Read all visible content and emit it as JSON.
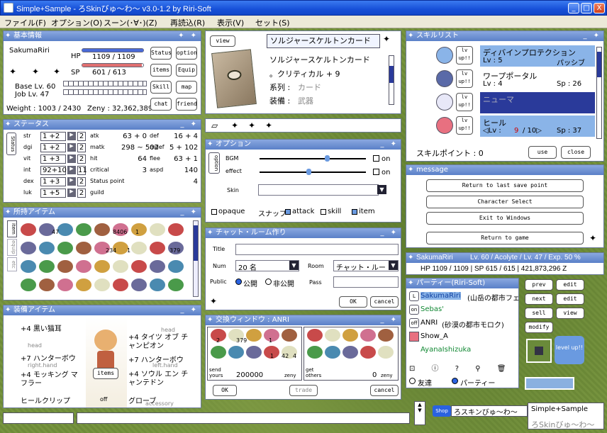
{
  "window": {
    "title": "Simple+Sample - ろSkinびゅ～わ～ v3.0-1.2 by Riri-Soft",
    "min": "_",
    "max": "□",
    "close": "X"
  },
  "menu": [
    "ファイル(F)",
    "オプション(O)",
    "スーン(･∀･)(Z)",
    "再読込(R)",
    "表示(V)",
    "セット(S)"
  ],
  "basic": {
    "title": "基本情報",
    "name": "SakumaRiri",
    "hp_label": "HP",
    "hp": "1109 / 1109",
    "sp_label": "SP",
    "sp": "601 / 613",
    "base_lv": "Base Lv. 60",
    "job_lv": "Job Lv. 47",
    "weight": "Weight : 1003 / 2430",
    "zeny": "Zeny : 32,362,389",
    "buttons": [
      "Status",
      "option",
      "items",
      "Equip",
      "Skill",
      "map",
      "chat",
      "friend"
    ],
    "hp_ratio": 1.0,
    "sp_ratio": 0.98
  },
  "status": {
    "title": "ステータス",
    "side": "Status",
    "rows": [
      {
        "k": "str",
        "v": "1 +2",
        "p": "2",
        "k2": "atk",
        "v2": "63 + 0",
        "k3": "def",
        "v3": "16 + 4"
      },
      {
        "k": "dgi",
        "v": "1 +2",
        "p": "2",
        "k2": "matk",
        "v2": "298 ~ 502",
        "k3": "mdef",
        "v3": "5 + 102"
      },
      {
        "k": "vit",
        "v": "1 +3",
        "p": "2",
        "k2": "hit",
        "v2": "64",
        "k3": "flee",
        "v3": "63 + 1"
      },
      {
        "k": "int",
        "v": "92+10",
        "p": "11",
        "k2": "critical",
        "v2": "3",
        "k3": "aspd",
        "v3": "140"
      },
      {
        "k": "dex",
        "v": "1 +3",
        "p": "2",
        "k2": "Status point",
        "v2": "",
        "k3": "",
        "v3": "4"
      },
      {
        "k": "luk",
        "v": "1 +5",
        "p": "2",
        "k2": "guild",
        "v2": "",
        "k3": "",
        "v3": ""
      }
    ]
  },
  "inventory": {
    "title": "所持アイテム",
    "tabs": [
      "item",
      "equip",
      "etc"
    ],
    "counts": [
      "47",
      "8406",
      "1",
      "234",
      "1",
      "379"
    ]
  },
  "equip": {
    "title": "装備アイテム",
    "left": [
      "+4 黒い猫耳",
      "head",
      "+7 ハンターボウ",
      "right.hand",
      "+4 モッキング マフラー",
      "ヒールクリップ"
    ],
    "right": [
      "head",
      "+4 タイツ オブ チャンピオン",
      "+7 ハンターボウ",
      "left.hand",
      "+4 ソウル エン チャンテドン",
      "グローブ",
      "accessory"
    ],
    "items": "items",
    "off": "off"
  },
  "card": {
    "view": "view",
    "title": "ソルジャースケルトンカード",
    "name": "ソルジャースケルトンカード",
    "line1": "。クリティカル + 9",
    "k1": "系列 :",
    "v1": "カード",
    "k2": "装備 :",
    "v2": "武器"
  },
  "option": {
    "title": "オプション",
    "side": "option",
    "bgm": "BGM",
    "effect": "effect",
    "on": "on",
    "skin": "Skin",
    "opaque": "opaque",
    "snap": "スナップ",
    "attack": "attack",
    "skill": "skill",
    "item": "item"
  },
  "chat": {
    "title": "チャット・ルーム作り",
    "title_label": "Title",
    "num_label": "Num",
    "num": "20 名",
    "room_label": "Room",
    "room": "チャット・ルー",
    "public_label": "Public",
    "public": "公開",
    "private": "非公開",
    "pass_label": "Pass",
    "ok": "OK",
    "cancel": "cancel"
  },
  "trade": {
    "title": "交換ウィンドウ : ANRI",
    "send": "send",
    "yours": "yours",
    "yours_zeny": "200000",
    "zeny": "zeny",
    "get": "get",
    "others": "others",
    "others_zeny": "0",
    "ok": "OK",
    "trade": "trade",
    "cancel": "cancel",
    "counts": [
      "2",
      "379",
      "1",
      "1",
      "42",
      "4"
    ]
  },
  "skills": {
    "title": "スキルリスト",
    "items": [
      {
        "name": "ディバインプロテクション",
        "lv": "Lv : 5",
        "extra": "パッシブ",
        "state": "lit"
      },
      {
        "name": "ワープポータル",
        "lv": "Lv : 4",
        "extra": "Sp : 26",
        "state": "plain"
      },
      {
        "name": "ニューマ",
        "lv": "",
        "extra": "",
        "state": "sel"
      },
      {
        "name": "ヒール",
        "lv": "◁Lv :",
        "lvnum": "9",
        "lvmax": "/ 10▷",
        "extra": "Sp : 37",
        "state": "lit"
      }
    ],
    "point": "スキルポイント : 0",
    "use": "use",
    "close": "close",
    "up": "lv up!!"
  },
  "message": {
    "title": "message",
    "buttons": [
      "Return to last save point",
      "Character Select",
      "Exit to Windows",
      "Return to game"
    ]
  },
  "charinfo": {
    "name": "SakumaRiri",
    "line1": "Lv. 60 / Acolyte / Lv. 47 / Exp. 50 %",
    "line2": "HP 1109 / 1109 | SP 615 / 615 | 421,873,296 Z"
  },
  "party": {
    "title": "パーティー(Riri-Soft)",
    "members": [
      {
        "tag": "L",
        "name": "SakumaRiri",
        "map": "(山岳の都市フェ",
        "c": "sel"
      },
      {
        "tag": "on",
        "name": "Sebas'",
        "map": "",
        "c": "green"
      },
      {
        "tag": "off",
        "name": "ANRI",
        "map": "(砂漠の都市モロク)",
        "c": "black"
      },
      {
        "tag": "",
        "name": "Show_A",
        "map": "",
        "c": "black"
      },
      {
        "tag": "",
        "name": "AyanaIshizuka",
        "map": "",
        "c": "green"
      }
    ],
    "friend": "友達",
    "party": "パーティー"
  },
  "side": {
    "buttons": [
      "prev",
      "edit",
      "next",
      "edit",
      "sell",
      "view",
      "modify"
    ],
    "levelup": "level up!!"
  },
  "bottom": {
    "shop": "Shop",
    "shopname": "ろスキンびゅ～わ～",
    "minimap": "Simple+Sample",
    "minimap2": "ろSkinびゅ～わ～"
  },
  "colors": {
    "titlebar": "#1750d8",
    "header": "#5a80c8",
    "hp": "#4a6ad8",
    "sp": "#e07070",
    "sel": "#2a3a9a",
    "lit": "#8ab4e8"
  }
}
